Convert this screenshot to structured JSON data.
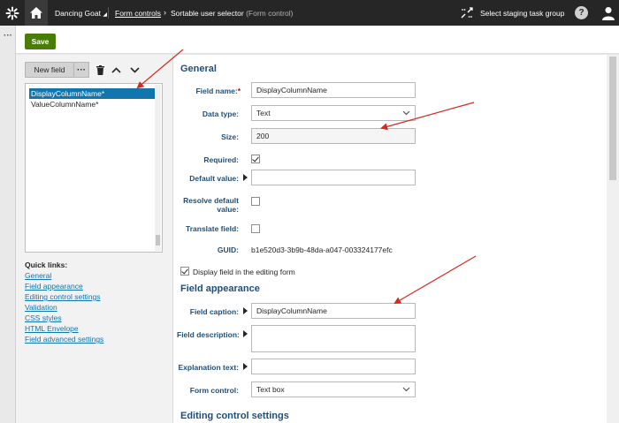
{
  "topbar": {
    "site_name": "Dancing Goat",
    "site_caret": "◢",
    "breadcrumb_parent": "Form controls",
    "breadcrumb_arrow": "›",
    "breadcrumb_current": "Sortable user selector",
    "breadcrumb_type": "(Form control)",
    "staging_label": "Select staging task group",
    "help_label": "?"
  },
  "left_strip": {
    "more_label": "···"
  },
  "actions": {
    "save_label": "Save"
  },
  "field_editor": {
    "new_field_label": "New field",
    "more_label": "···",
    "fields": [
      "DisplayColumnName*",
      "ValueColumnName*"
    ],
    "selected_index": 0,
    "quick_links_title": "Quick links:",
    "quick_links": [
      "General",
      "Field appearance",
      "Editing control settings",
      "Validation",
      "CSS styles",
      "HTML Envelope",
      "Field advanced settings"
    ]
  },
  "general": {
    "heading": "General",
    "field_name_label": "Field name:",
    "required_mark": "*",
    "field_name_value": "DisplayColumnName",
    "data_type_label": "Data type:",
    "data_type_value": "Text",
    "size_label": "Size:",
    "size_value": "200",
    "required_label": "Required:",
    "required_checked": true,
    "default_value_label": "Default value:",
    "default_value": "",
    "resolve_default_label_1": "Resolve default",
    "resolve_default_label_2": "value:",
    "resolve_checked": false,
    "translate_label": "Translate field:",
    "translate_checked": false,
    "guid_label": "GUID:",
    "guid_value": "b1e520d3-3b9b-48da-a047-003324177efc",
    "display_in_form_label": "Display field in the editing form",
    "display_in_form_checked": true
  },
  "appearance": {
    "heading": "Field appearance",
    "caption_label": "Field caption:",
    "caption_value": "DisplayColumnName",
    "description_label": "Field description:",
    "explanation_label": "Explanation text:",
    "form_control_label": "Form control:",
    "form_control_value": "Text box"
  },
  "editing_control": {
    "heading": "Editing control settings"
  },
  "colors": {
    "accent": "#1175ae",
    "save": "#497d04",
    "label": "#1f4e79",
    "topbar": "#262626",
    "arrow": "#d9281e"
  }
}
